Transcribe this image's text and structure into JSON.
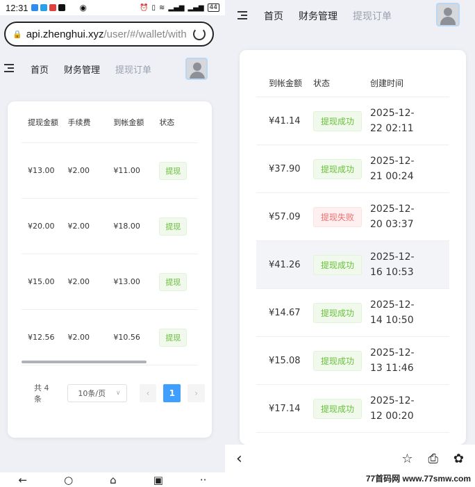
{
  "status_bar": {
    "time": "12:31",
    "battery": "44"
  },
  "browser": {
    "url_host": "api.zhenghui.xyz",
    "url_path": "/user/#/wallet/with"
  },
  "nav": {
    "home": "首页",
    "finance": "财务管理",
    "withdraw_orders": "提现订单"
  },
  "left_table": {
    "headers": [
      "提现金额",
      "手续费",
      "到帐金额",
      "状态"
    ],
    "rows": [
      {
        "amount": "¥13.00",
        "fee": "¥2.00",
        "received": "¥11.00",
        "status": "提现"
      },
      {
        "amount": "¥20.00",
        "fee": "¥2.00",
        "received": "¥18.00",
        "status": "提现"
      },
      {
        "amount": "¥15.00",
        "fee": "¥2.00",
        "received": "¥13.00",
        "status": "提现"
      },
      {
        "amount": "¥12.56",
        "fee": "¥2.00",
        "received": "¥10.56",
        "status": "提现"
      }
    ]
  },
  "pagination": {
    "total": "共 4 条",
    "page_size": "10条/页",
    "prev": "‹",
    "current": "1",
    "next": "›"
  },
  "right_table": {
    "headers": [
      "到帐金额",
      "状态",
      "创建时间"
    ],
    "rows": [
      {
        "received": "¥41.14",
        "status": "提现成功",
        "ok": true,
        "date": "2025-12-",
        "time": "22 02:11"
      },
      {
        "received": "¥37.90",
        "status": "提现成功",
        "ok": true,
        "date": "2025-12-",
        "time": "21 00:24"
      },
      {
        "received": "¥57.09",
        "status": "提现失败",
        "ok": false,
        "date": "2025-12-",
        "time": "20 03:37"
      },
      {
        "received": "¥41.26",
        "status": "提现成功",
        "ok": true,
        "date": "2025-12-",
        "time": "16 10:53"
      },
      {
        "received": "¥14.67",
        "status": "提现成功",
        "ok": true,
        "date": "2025-12-",
        "time": "14 10:50"
      },
      {
        "received": "¥15.08",
        "status": "提现成功",
        "ok": true,
        "date": "2025-12-",
        "time": "13 11:46"
      },
      {
        "received": "¥17.14",
        "status": "提现成功",
        "ok": true,
        "date": "2025-12-",
        "time": "12 00:20"
      }
    ]
  },
  "watermark": "77首码网 www.77smw.com",
  "icons": [
    "menu-icon",
    "avatar-icon",
    "reload-icon",
    "back-icon",
    "star-icon",
    "inbox-icon",
    "paw-icon"
  ]
}
